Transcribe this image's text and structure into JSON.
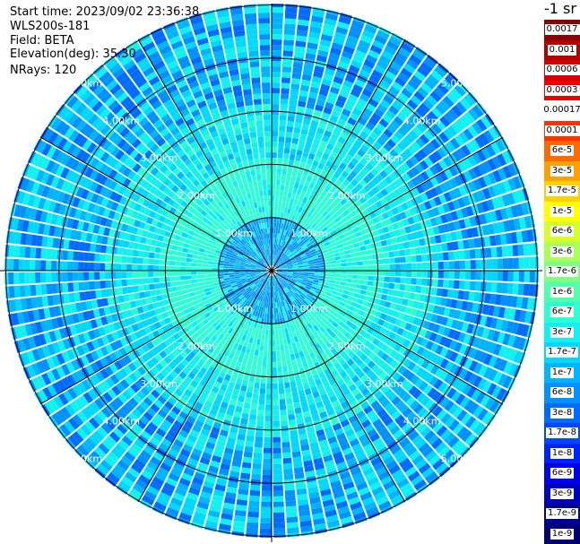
{
  "info": {
    "start_time": "Start time: 2023/09/02 23:36:38",
    "instrument": "WLS200s-181",
    "field": "Field: BETA",
    "elevation": "Elevation(deg): 35.30",
    "nrays": "NRays: 120"
  },
  "units": "-1 sr",
  "colorbar": [
    {
      "label": "0.0017",
      "color": "#8b0000"
    },
    {
      "label": "0.001",
      "color": "#b00000"
    },
    {
      "label": "0.0006",
      "color": "#d40000"
    },
    {
      "label": "0.0003",
      "color": "#f00000"
    },
    {
      "label": "0.00017",
      "color": "#ffffff"
    },
    {
      "label": "0.0001",
      "color": "#ff3000"
    },
    {
      "label": "6e-5",
      "color": "#ff6a00"
    },
    {
      "label": "3e-5",
      "color": "#ff9f00"
    },
    {
      "label": "1.7e-5",
      "color": "#ffd000"
    },
    {
      "label": "1e-5",
      "color": "#ffff00"
    },
    {
      "label": "6e-6",
      "color": "#d6ff29"
    },
    {
      "label": "3e-6",
      "color": "#a8ff57"
    },
    {
      "label": "1.7e-6",
      "color": "#7dff82"
    },
    {
      "label": "1e-6",
      "color": "#52ffad"
    },
    {
      "label": "6e-7",
      "color": "#2bffd4"
    },
    {
      "label": "3e-7",
      "color": "#12f0f0"
    },
    {
      "label": "1.7e-7",
      "color": "#00d8ff"
    },
    {
      "label": "1e-7",
      "color": "#00b4ff"
    },
    {
      "label": "6e-8",
      "color": "#0090ff"
    },
    {
      "label": "3e-8",
      "color": "#006cff"
    },
    {
      "label": "1.7e-8",
      "color": "#0048ff"
    },
    {
      "label": "1e-8",
      "color": "#0020ff"
    },
    {
      "label": "6e-9",
      "color": "#0000e8"
    },
    {
      "label": "3e-9",
      "color": "#0000c0"
    },
    {
      "label": "1.7e-9",
      "color": "#000098"
    },
    {
      "label": "1e-9",
      "color": "#000070"
    }
  ],
  "range_rings": [
    {
      "label": "1.00km"
    },
    {
      "label": "2.00km"
    },
    {
      "label": "3.00km"
    },
    {
      "label": "4.00km"
    },
    {
      "label": "5.00km"
    }
  ]
}
